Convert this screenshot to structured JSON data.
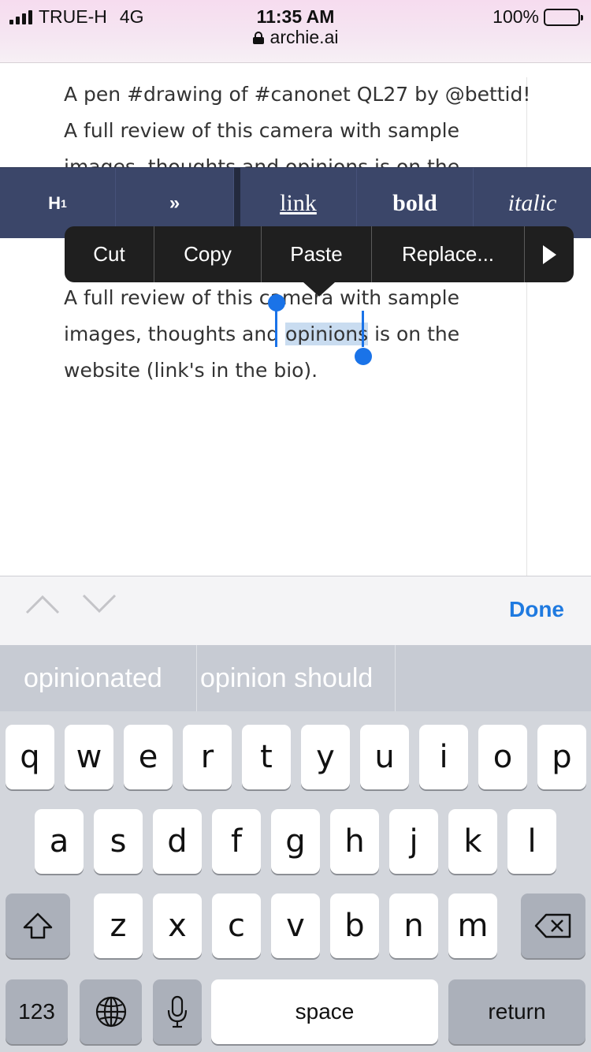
{
  "status_bar": {
    "carrier": "TRUE-H",
    "network": "4G",
    "time": "11:35 AM",
    "url": "archie.ai",
    "battery": "100%",
    "battery_level": 1.0
  },
  "editor": {
    "line1": "A pen #drawing of #canonet QL27 by @bettid!",
    "line2": "A full review of this camera with sample",
    "line3_partial": "images, thoughts and opinions is on the",
    "para2_line1": "A full review of this camera with sample",
    "para2_line2_before": "images, thoughts and ",
    "para2_line2_selected": "opinions",
    "para2_line2_after": " is on the",
    "para2_line3": "website (link's in the bio)."
  },
  "format_toolbar": {
    "h1_main": "H",
    "h1_sub": "1",
    "more": "»",
    "link": "link",
    "bold": "bold",
    "italic": "italic"
  },
  "context_menu": {
    "cut": "Cut",
    "copy": "Copy",
    "paste": "Paste",
    "replace": "Replace...",
    "more_icon": "play-triangle-icon"
  },
  "accessory_bar": {
    "prev_icon": "chevron-up-icon",
    "next_icon": "chevron-down-icon",
    "done": "Done"
  },
  "predictive": {
    "s1": "opinionated",
    "s2": "opinion should",
    "s3": ""
  },
  "keyboard": {
    "row1": [
      "q",
      "w",
      "e",
      "r",
      "t",
      "y",
      "u",
      "i",
      "o",
      "p"
    ],
    "row2": [
      "a",
      "s",
      "d",
      "f",
      "g",
      "h",
      "j",
      "k",
      "l"
    ],
    "row3": [
      "z",
      "x",
      "c",
      "v",
      "b",
      "n",
      "m"
    ],
    "numbers": "123",
    "space": "space",
    "return": "return",
    "shift_icon": "shift-icon",
    "delete_icon": "delete-icon",
    "globe_icon": "globe-icon",
    "mic_icon": "microphone-icon"
  },
  "colors": {
    "accent": "#1f7ae0",
    "toolbar": "#3b4669",
    "selection": "#c9dcf0"
  }
}
